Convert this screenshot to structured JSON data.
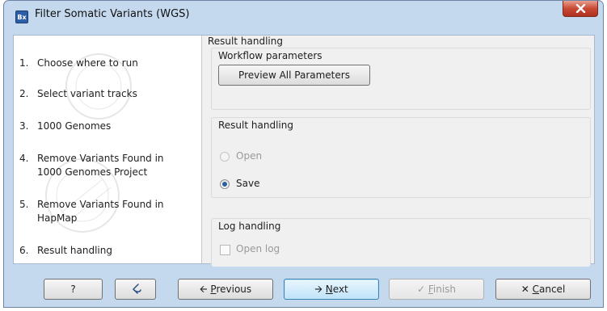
{
  "window": {
    "title": "Filter Somatic Variants (WGS)",
    "app_icon_text": "Bx"
  },
  "steps": [
    {
      "num": "1.",
      "label": "Choose where to run"
    },
    {
      "num": "2.",
      "label": "Select variant tracks"
    },
    {
      "num": "3.",
      "label": "1000 Genomes"
    },
    {
      "num": "4.",
      "label": "Remove Variants Found in",
      "label2": "1000 Genomes Project"
    },
    {
      "num": "5.",
      "label": "Remove Variants Found in",
      "label2": "HapMap"
    },
    {
      "num": "6.",
      "label": "Result handling"
    }
  ],
  "panel": {
    "title": "Result handling",
    "workflow_params": {
      "label": "Workflow parameters",
      "preview_button": "Preview All Parameters"
    },
    "result_handling": {
      "label": "Result handling",
      "open_label": "Open",
      "save_label": "Save",
      "selected": "Save"
    },
    "log_handling": {
      "label": "Log handling",
      "open_log_label": "Open log",
      "open_log_checked": false
    }
  },
  "footer": {
    "help": "?",
    "previous_prefix": "",
    "previous_u": "P",
    "previous_rest": "revious",
    "next_u": "N",
    "next_rest": "ext",
    "finish_u": "F",
    "finish_rest": "inish",
    "cancel_u": "C",
    "cancel_rest": "ancel"
  },
  "colors": {
    "window_frame": "#c4d8ee",
    "close_button": "#c84a35",
    "focus_button": "#bfe3f9",
    "radio_selected": "#2a5fa0"
  }
}
